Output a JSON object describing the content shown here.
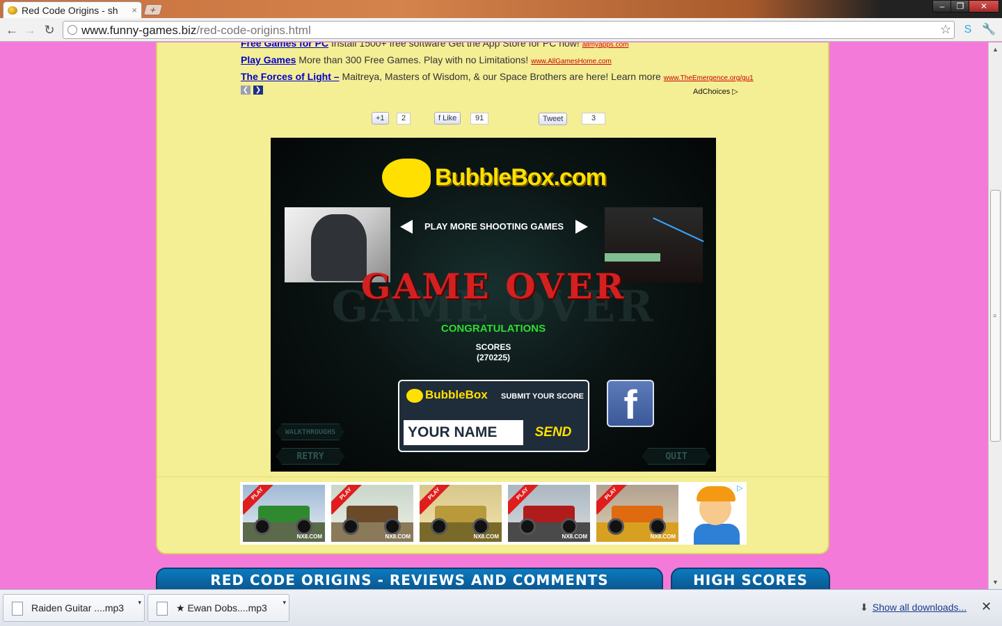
{
  "browser": {
    "tab_title": "Red Code Origins - sh",
    "url_host": "www.funny-games.biz",
    "url_path": "/red-code-origins.html",
    "icons": [
      "favicon",
      "close-icon",
      "new-tab-icon",
      "back-icon",
      "forward-icon",
      "reload-icon",
      "globe-icon",
      "star-icon",
      "skype-icon",
      "wrench-icon"
    ]
  },
  "ads": [
    {
      "link": "Free Games for PC",
      "text": " Install 1500+ free software Get the App Store for PC now!",
      "source": "allmyapps.com"
    },
    {
      "link": "Play Games",
      "text": " More than 300 Free Games. Play with no Limitations!",
      "source": "www.AllGamesHome.com"
    },
    {
      "link": "The Forces of Light –",
      "text": " Maitreya, Masters of Wisdom, & our Space Brothers are here! Learn more",
      "source": "www.TheEmergence.org/gu1"
    }
  ],
  "adchoices": "AdChoices ▷",
  "social": {
    "gplus_label": "+1",
    "gplus_count": "2",
    "like_label": "f Like",
    "like_count": "91",
    "tweet_label": "Tweet",
    "tweet_count": "3"
  },
  "game": {
    "logo": "BubbleBox.com",
    "play_more": "PLAY MORE SHOOTING GAMES",
    "game_over": "GAME OVER",
    "congrats": "CONGRATULATIONS",
    "scores_label": "SCORES",
    "scores_value": "(270225)",
    "submit_logo": "BubbleBox",
    "submit_label": "SUBMIT YOUR SCORE",
    "name_placeholder": "YOUR NAME",
    "send": "SEND",
    "facebook": "f",
    "walkthroughs": "WALKTHROUGHS",
    "retry": "RETRY",
    "quit": "QUIT"
  },
  "ad_strip": {
    "ribbon": "PLAY",
    "brand": "NX8.COM",
    "colors": [
      "#2f8a2f",
      "#6b4a2a",
      "#b89a3a",
      "#b01c1c",
      "#e06a10"
    ]
  },
  "sections": {
    "reviews_title": "RED CODE ORIGINS - REVIEWS AND COMMENTS",
    "highscores_title": "HIGH SCORES"
  },
  "downloads": {
    "items": [
      "Raiden Guitar ....mp3",
      "★ Ewan Dobs....mp3"
    ],
    "show_all": "Show all downloads..."
  }
}
